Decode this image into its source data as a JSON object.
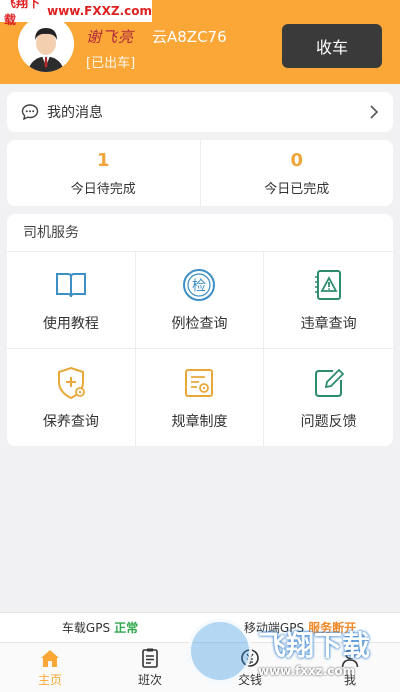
{
  "watermark": {
    "top_a": "飞翔下载",
    "top_b": "www.FXXZ.com",
    "bottom_title": "飞翔下载",
    "bottom_url": "www.fxxz.com"
  },
  "header": {
    "driver_name": "谢飞亮",
    "plate": "云A8ZC76",
    "status": "[已出车]",
    "collect_button": "收车",
    "color": "#fba738"
  },
  "messages": {
    "label": "我的消息"
  },
  "stats": [
    {
      "value": "1",
      "label": "今日待完成"
    },
    {
      "value": "0",
      "label": "今日已完成"
    }
  ],
  "services": {
    "title": "司机服务",
    "items": [
      {
        "label": "使用教程",
        "icon": "book-icon"
      },
      {
        "label": "例检查询",
        "icon": "inspection-icon"
      },
      {
        "label": "违章查询",
        "icon": "violation-warning-icon"
      },
      {
        "label": "保养查询",
        "icon": "maintenance-shield-icon"
      },
      {
        "label": "规章制度",
        "icon": "rules-document-icon"
      },
      {
        "label": "问题反馈",
        "icon": "feedback-edit-icon"
      }
    ]
  },
  "gps": {
    "vehicle_label": "车载GPS",
    "vehicle_status": "正常",
    "mobile_label": "移动端GPS",
    "mobile_status": "服务断开"
  },
  "tabs": [
    {
      "label": "主页",
      "icon": "home-icon",
      "active": true
    },
    {
      "label": "班次",
      "icon": "clipboard-icon",
      "active": false
    },
    {
      "label": "交钱",
      "icon": "money-icon",
      "active": false
    },
    {
      "label": "我",
      "icon": "user-icon",
      "active": false
    }
  ]
}
